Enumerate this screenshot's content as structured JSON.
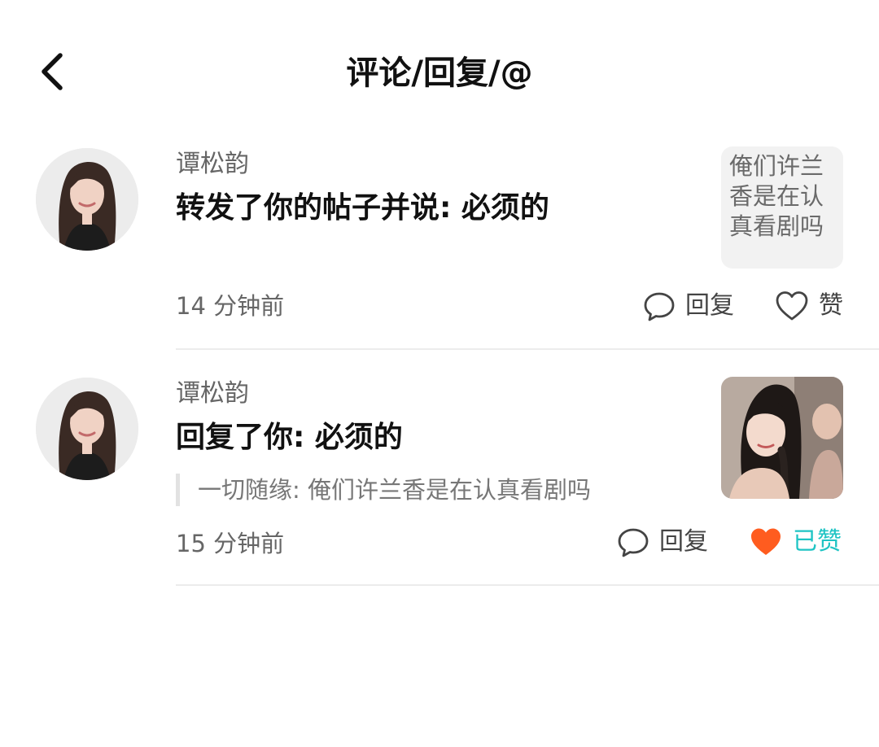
{
  "header": {
    "title": "评论/回复/@",
    "back_icon": "chevron-left-icon"
  },
  "notifications": [
    {
      "username": "谭松韵",
      "message": "转发了你的帖子并说: 必须的",
      "post_preview_text": "俺们许兰香是在认真看剧吗",
      "timestamp": "14 分钟前",
      "reply_label": "回复",
      "like_label": "赞",
      "liked": false
    },
    {
      "username": "谭松韵",
      "message": "回复了你: 必须的",
      "quote": "一切随缘: 俺们许兰香是在认真看剧吗",
      "timestamp": "15 分钟前",
      "reply_label": "回复",
      "like_label": "已赞",
      "liked": true
    }
  ],
  "colors": {
    "liked_heart": "#ff5c1f",
    "liked_text": "#1fc4c4",
    "secondary_text": "#666666"
  }
}
